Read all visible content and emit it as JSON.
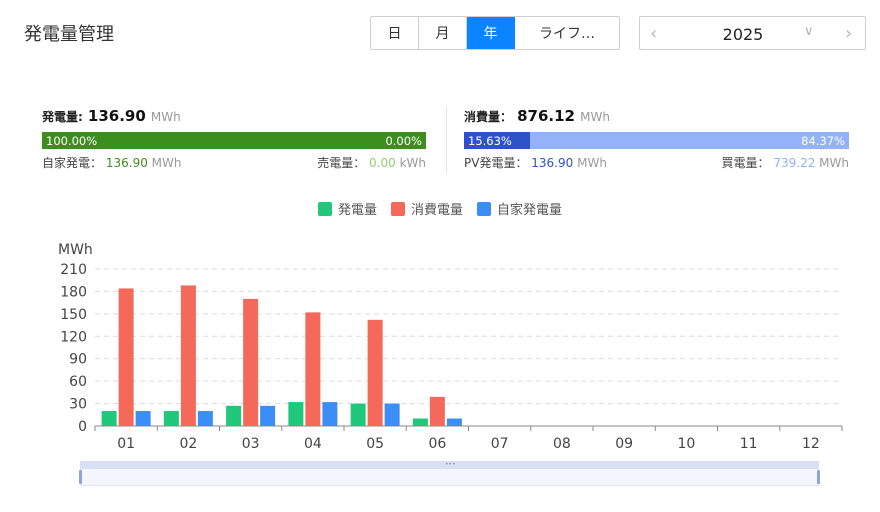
{
  "page": {
    "title": "発電量管理"
  },
  "tabs": [
    {
      "label": "日",
      "active": false
    },
    {
      "label": "月",
      "active": false
    },
    {
      "label": "年",
      "active": true
    },
    {
      "label": "ライフ…",
      "active": false
    }
  ],
  "year_picker": {
    "value": "2025",
    "prev_icon": "chevron-left-icon",
    "dropdown_icon": "chevron-down-icon",
    "next_icon": "chevron-right-icon"
  },
  "generation": {
    "label": "発電量:",
    "value": "136.90",
    "unit": "MWh",
    "bar": {
      "left_pct_label": "100.00%",
      "right_pct_label": "0.00%",
      "left_fraction": 1.0,
      "left_color": "#3e8e1f",
      "right_color": "#3e8e1f"
    },
    "self_label": "自家発電：",
    "self_value": "136.90",
    "self_unit": "MWh",
    "sell_label": "売電量：",
    "sell_value": "0.00",
    "sell_unit": "kWh",
    "self_value_color": "#3e8e1f",
    "sell_value_color": "#8fd16f"
  },
  "consumption": {
    "label": "消費量：",
    "value": "876.12",
    "unit": "MWh",
    "bar": {
      "left_pct_label": "15.63%",
      "right_pct_label": "84.37%",
      "left_fraction": 0.1563,
      "left_color": "#2d53c6",
      "right_color": "#93b2f7"
    },
    "pv_label": "PV発電量：",
    "pv_value": "136.90",
    "pv_unit": "MWh",
    "buy_label": "買電量：",
    "buy_value": "739.22",
    "buy_unit": "MWh",
    "pv_value_color": "#2d53c6",
    "buy_value_color": "#93b2f7"
  },
  "legend": [
    {
      "name": "発電量",
      "color": "#1fc87a"
    },
    {
      "name": "消費電量",
      "color": "#f4695a"
    },
    {
      "name": "自家発電量",
      "color": "#3a8ef6"
    }
  ],
  "chart_data": {
    "type": "bar",
    "ylabel": "MWh",
    "ylim": [
      0,
      210
    ],
    "yticks": [
      0,
      30,
      60,
      90,
      120,
      150,
      180,
      210
    ],
    "grid": true,
    "legend_position": "top-center",
    "categories": [
      "01",
      "02",
      "03",
      "04",
      "05",
      "06",
      "07",
      "08",
      "09",
      "10",
      "11",
      "12"
    ],
    "series": [
      {
        "name": "発電量",
        "color": "#1fc87a",
        "values": [
          20,
          20,
          27,
          32,
          30,
          10,
          0,
          0,
          0,
          0,
          0,
          0
        ]
      },
      {
        "name": "消費電量",
        "color": "#f4695a",
        "values": [
          184,
          188,
          170,
          152,
          142,
          39,
          0,
          0,
          0,
          0,
          0,
          0
        ]
      },
      {
        "name": "自家発電量",
        "color": "#3a8ef6",
        "values": [
          20,
          20,
          27,
          32,
          30,
          10,
          0,
          0,
          0,
          0,
          0,
          0
        ]
      }
    ]
  },
  "zoom": {
    "start_fraction": 0.0,
    "end_fraction": 1.0,
    "grip_icon": "grip-icon"
  }
}
